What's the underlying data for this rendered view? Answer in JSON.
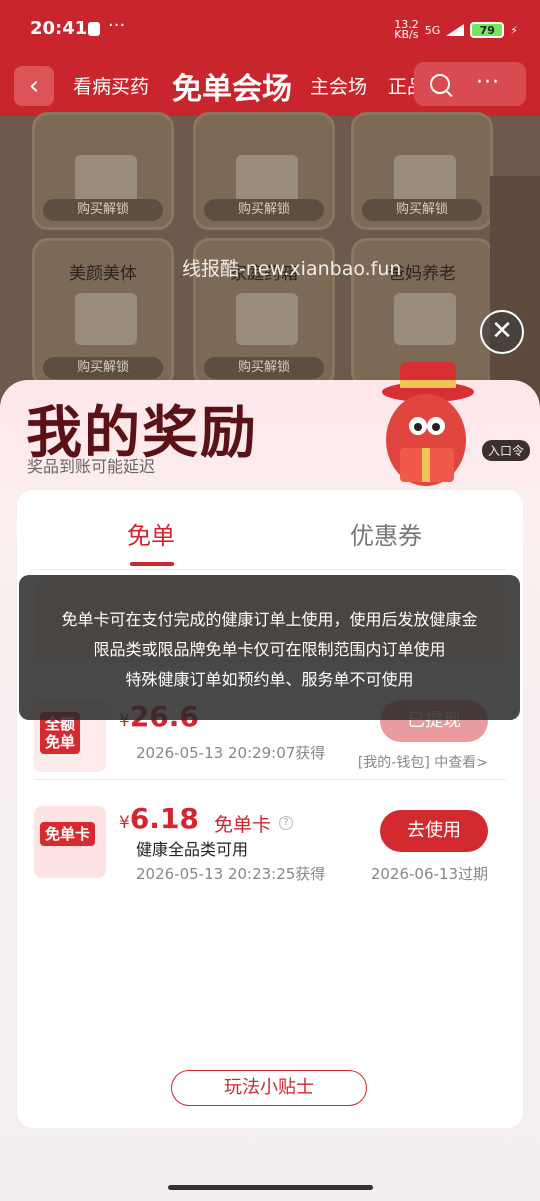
{
  "status": {
    "time": "20:41",
    "dots": "···",
    "net_speed": "13.2\nKB/s",
    "network": "5G",
    "battery": "79"
  },
  "nav": {
    "back": "‹",
    "tabs": [
      "看病买药",
      "免单会场",
      "主会场",
      "正品"
    ],
    "more": "···"
  },
  "background": {
    "tiles": [
      {
        "label": "",
        "lock": "购买解锁"
      },
      {
        "label": "",
        "lock": "购买解锁"
      },
      {
        "label": "",
        "lock": "购买解锁"
      },
      {
        "label": "美颜美体",
        "lock": "购买解锁"
      },
      {
        "label": "家庭药箱",
        "lock": "购买解锁"
      },
      {
        "label": "爸妈养老",
        "lock": ""
      }
    ],
    "watermark": "线报酷-new.xianbao.fun",
    "entry_tag": "入口令"
  },
  "sheet": {
    "title": "我的奖励",
    "subtitle": "奖品到账可能延迟",
    "tabs": {
      "free": "免单",
      "coupon": "优惠券"
    },
    "rows": [
      {
        "thumb_label": "全额\n免单",
        "currency": "¥",
        "amount": "26.6",
        "time": "2026-05-13 20:29:07获得",
        "button": "已提现",
        "link": "[我的-钱包] 中查看>"
      },
      {
        "thumb_label": "免单卡",
        "currency": "¥",
        "amount": "6.18",
        "tag": "免单卡",
        "desc": "健康全品类可用",
        "time": "2026-05-13 20:23:25获得",
        "button": "去使用",
        "expire": "2026-06-13过期"
      }
    ],
    "tips_button": "玩法小贴士"
  },
  "toast": {
    "line1": "免单卡可在支付完成的健康订单上使用，使用后发放健康金",
    "line2": "限品类或限品牌免单卡仅可在限制范围内订单使用",
    "line3": "特殊健康订单如预约单、服务单不可使用"
  },
  "colors": {
    "brand_red": "#c8262c",
    "accent_red": "#d2262e"
  }
}
